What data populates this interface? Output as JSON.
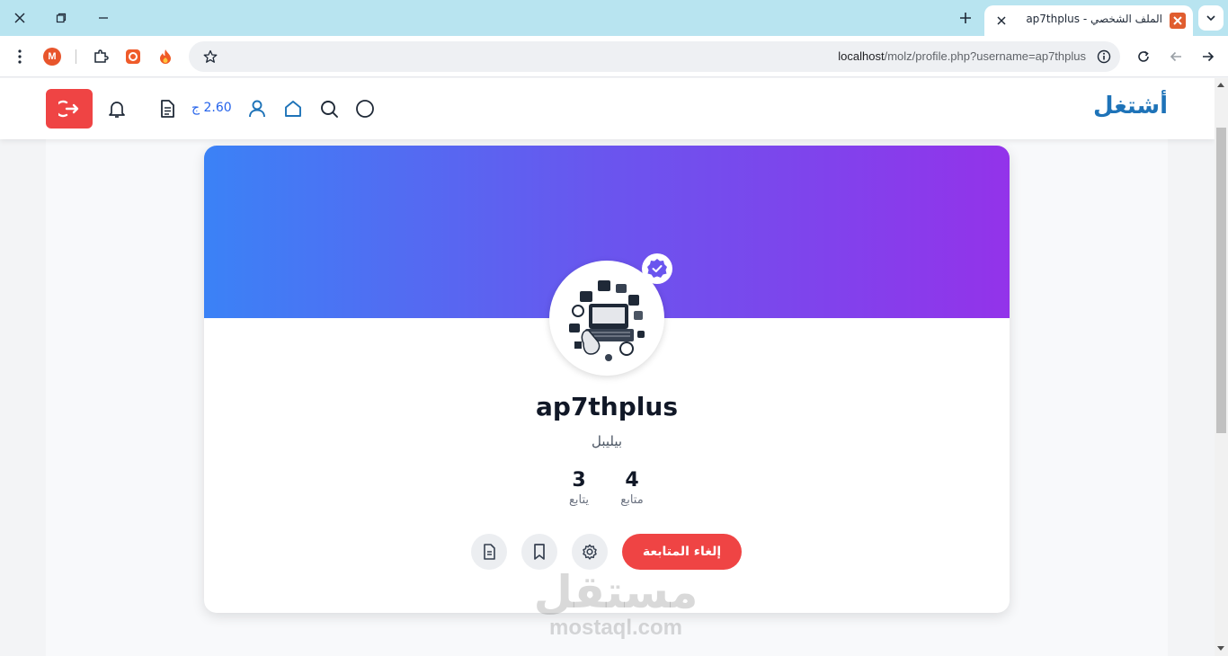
{
  "browser": {
    "tab_title": "الملف الشخصي - ap7thplus",
    "url_host": "localhost",
    "url_path": "/molz/profile.php?username=ap7thplus",
    "extension_m_label": "M"
  },
  "navbar": {
    "brand": "أشتغل",
    "balance": "2.60 ج"
  },
  "profile": {
    "username": "ap7thplus",
    "bio": "بيليبل",
    "followers_count": "4",
    "followers_label": "متابع",
    "following_count": "3",
    "following_label": "يتابع",
    "unfollow_label": "إلغاء المتابعة"
  },
  "watermark": {
    "arabic": "مستقل",
    "latin": "mostaql.com"
  },
  "colors": {
    "accent": "#2563eb",
    "brand": "#1e73b8",
    "danger": "#ef4444",
    "cover_start": "#3b82f6",
    "cover_end": "#9333ea",
    "tab_strip": "#b8e4f0"
  },
  "icons": {
    "window": [
      "close-window-icon",
      "restore-window-icon",
      "minimize-window-icon"
    ],
    "nav": [
      "theme-toggle-icon",
      "search-icon",
      "home-icon",
      "user-icon",
      "document-icon",
      "bell-icon",
      "logout-icon"
    ],
    "profile_actions": [
      "settings-icon",
      "bookmark-icon",
      "document-icon"
    ]
  }
}
